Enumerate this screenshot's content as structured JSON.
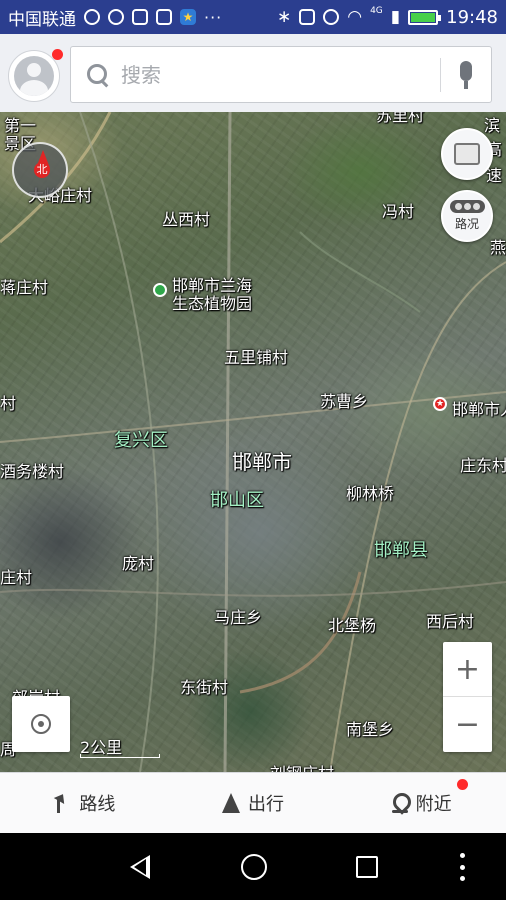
{
  "status_bar": {
    "carrier": "中国联通",
    "network": "4G",
    "time": "19:48",
    "battery_level": 0.9,
    "icons": [
      "location-icon",
      "wechat-icon",
      "app-icon",
      "app-icon",
      "star-app-icon",
      "more-dots-icon",
      "bluetooth-icon",
      "vibrate-icon",
      "alarm-icon",
      "wifi-icon",
      "signal-icon",
      "battery-icon"
    ]
  },
  "search": {
    "placeholder": "搜索"
  },
  "map": {
    "compass_label": "北",
    "traffic_label": "路况",
    "scale_label": "2公里",
    "labels": {
      "l1": "第一",
      "l2": "景区",
      "l3": "大峪庄村",
      "l4": "丛西村",
      "l5": "冯村",
      "l6": "蒋庄村",
      "l7": "邯郸市兰海",
      "l8": "生态植物园",
      "l9": "五里铺村",
      "l10": "村",
      "l11": "苏曹乡",
      "l12": "邯郸市人",
      "l13": "复兴区",
      "l14": "邯郸市",
      "l15": "酒务楼村",
      "l16": "柳林桥",
      "l17": "邯山区",
      "l18": "邯郸县",
      "l19": "庄村",
      "l20": "庞村",
      "l21": "马庄乡",
      "l22": "北堡杨",
      "l23": "西后村",
      "l24": "东街村",
      "l25": "南堡乡",
      "l26": "庄东村",
      "l27": "燕",
      "l28": "苏里村",
      "l29": "郊岸村",
      "l30": "刘钢庄村",
      "l31": "周",
      "l32": "滨",
      "l33": "高",
      "l34": "速"
    }
  },
  "toolbar": {
    "route_label": "路线",
    "go_label": "出行",
    "nearby_label": "附近"
  },
  "colors": {
    "status_bar": "#2b3e8f",
    "accent_red": "#ff2a2a",
    "district_label": "#a4f0c4"
  }
}
